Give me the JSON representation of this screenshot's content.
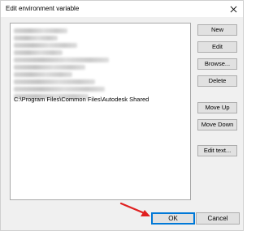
{
  "window": {
    "title": "Edit environment variable"
  },
  "list": {
    "visible_entry": "C:\\Program Files\\Common Files\\Autodesk Shared"
  },
  "buttons": {
    "new": "New",
    "edit": "Edit",
    "browse": "Browse...",
    "delete": "Delete",
    "move_up": "Move Up",
    "move_down": "Move Down",
    "edit_text": "Edit text..."
  },
  "footer": {
    "ok": "OK",
    "cancel": "Cancel"
  },
  "colors": {
    "accent": "#0078d7",
    "arrow": "#e02020"
  }
}
